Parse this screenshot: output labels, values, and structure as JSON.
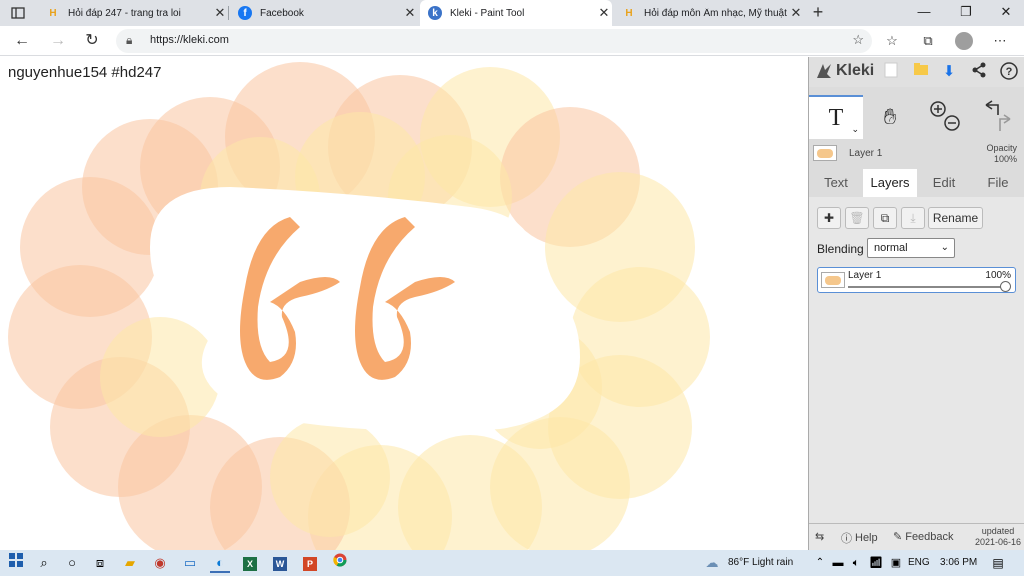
{
  "browser": {
    "tabs": [
      {
        "title": "Hỏi đáp 247 - trang tra loi",
        "favicon": "H"
      },
      {
        "title": "Facebook",
        "favicon": "f"
      },
      {
        "title": "Kleki - Paint Tool",
        "favicon": "k"
      },
      {
        "title": "Hỏi đáp môn Âm nhạc, Mỹ thuật",
        "favicon": "H"
      }
    ],
    "url": "https://kleki.com"
  },
  "canvas": {
    "watermark": "nguyenhue154  #hd247",
    "colors": {
      "orange": "#f7a96d",
      "blob": "#fbd3a8",
      "yellow": "#fde7a8",
      "peach": "#f9c5a0"
    }
  },
  "panel": {
    "logo": "Kleki",
    "layer_strip": {
      "name": "Layer 1",
      "opacity_label": "Opacity",
      "opacity": "100%"
    },
    "tabs": [
      "Text",
      "Layers",
      "Edit",
      "File"
    ],
    "rename": "Rename",
    "blending_label": "Blending",
    "blending_value": "normal",
    "layer": {
      "name": "Layer 1",
      "opacity": "100%"
    },
    "footer": {
      "help": "Help",
      "feedback": "Feedback",
      "updated_label": "updated",
      "updated_date": "2021-06-16"
    }
  },
  "taskbar": {
    "weather": "86°F  Light rain",
    "lang": "ENG",
    "time": "3:06 PM"
  }
}
